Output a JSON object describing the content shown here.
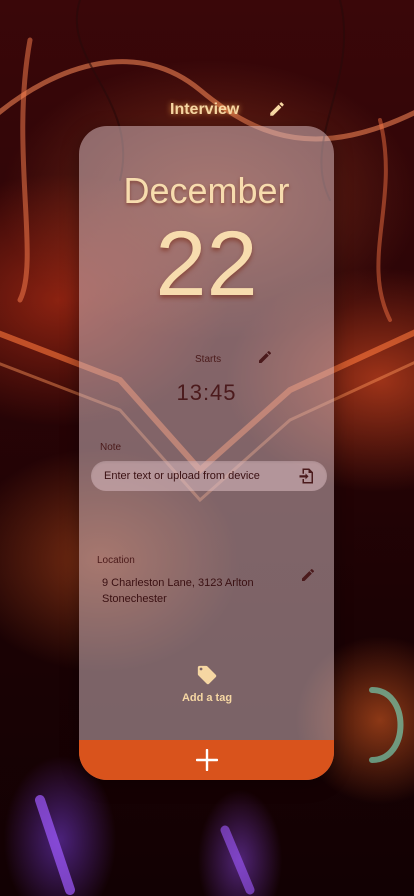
{
  "event": {
    "title": "Interview",
    "month": "December",
    "day": "22"
  },
  "starts": {
    "label": "Starts",
    "time": "13:45"
  },
  "note": {
    "label": "Note",
    "placeholder": "Enter text or upload from device",
    "value": ""
  },
  "location": {
    "label": "Location",
    "value": "9 Charleston Lane, 3123 Arlton Stonechester"
  },
  "tag": {
    "label": "Add a tag"
  },
  "icons": {
    "title_edit": "pencil-icon",
    "starts_edit": "pencil-icon",
    "upload": "file-import-icon",
    "location_edit": "pencil-icon",
    "tag": "tag-icon",
    "add": "plus-icon"
  },
  "colors": {
    "accent": "#d9531c",
    "title_text": "#f6d7a3",
    "dark_text": "#3a1012"
  }
}
